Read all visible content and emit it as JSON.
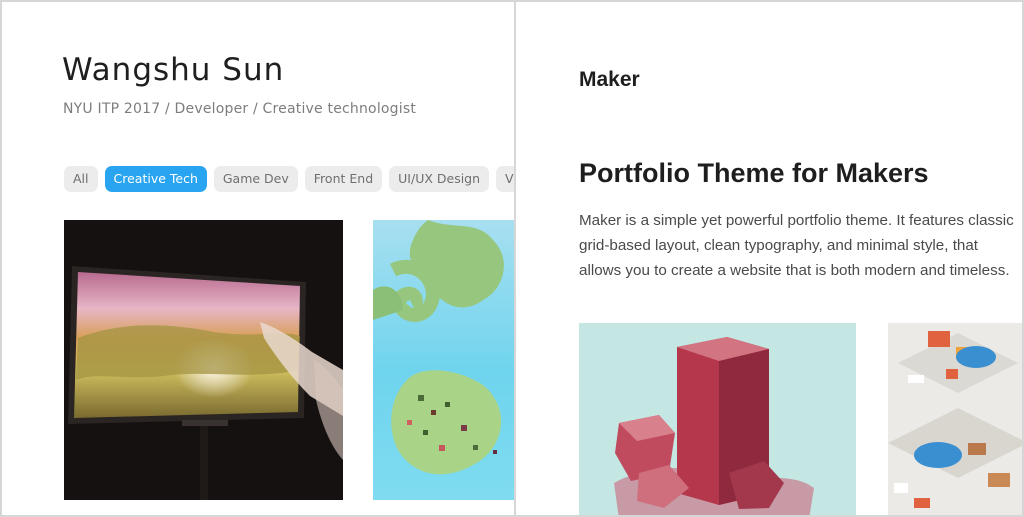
{
  "left_site": {
    "name": "Wangshu Sun",
    "tagline": "NYU ITP 2017 / Developer / Creative technologist",
    "filters": [
      {
        "label": "All",
        "active": false
      },
      {
        "label": "Creative Tech",
        "active": true
      },
      {
        "label": "Game Dev",
        "active": false
      },
      {
        "label": "Front End",
        "active": false
      },
      {
        "label": "UI/UX Design",
        "active": false
      },
      {
        "label": "Visual De",
        "active": false
      }
    ],
    "projects": [
      {
        "image": "projection-screen-photo"
      },
      {
        "image": "floating-islands-render"
      }
    ]
  },
  "right_site": {
    "brand": "Maker",
    "hero_title": "Portfolio Theme for Makers",
    "hero_description": "Maker is a simple yet powerful portfolio theme. It features classic grid-based layout, clean typography, and minimal style, that allows you to create a website that is both modern and timeless.",
    "works": [
      {
        "image": "red-crystal-illustration"
      },
      {
        "image": "isometric-blocks-illustration"
      }
    ]
  },
  "colors": {
    "active_chip": "#29a4f0",
    "chip": "#ececec",
    "divider": "#d6d6d6",
    "title": "#1e1e1e"
  }
}
